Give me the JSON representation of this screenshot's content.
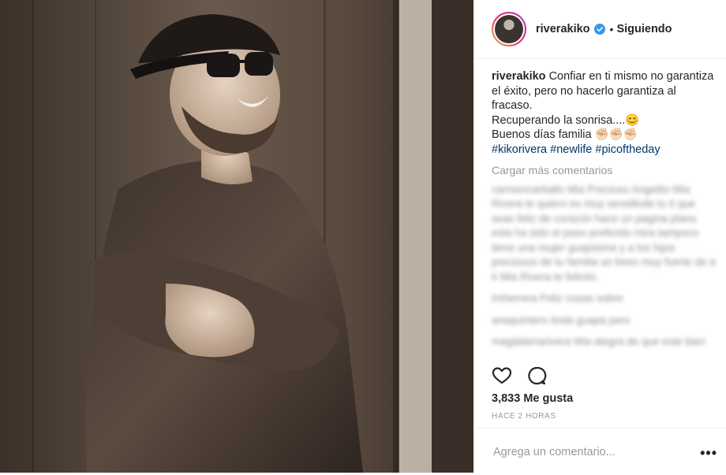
{
  "post": {
    "username": "riverakiko",
    "following_label": "Siguiendo",
    "separator": "•",
    "caption_user": "riverakiko",
    "caption_lines": [
      "Confiar en ti mismo no garantiza el éxito, pero no hacerlo garantiza al fracaso.",
      "Recuperando la sonrisa....😊",
      "Buenos días familia ✊🏻✊🏻✊🏻"
    ],
    "hashtags": [
      "#kikorivera",
      "#newlife",
      "#picoftheday"
    ],
    "load_more": "Cargar más comentarios",
    "blurred_comments": [
      "carmencarballo Mia Precioso Angelito Mia Rivera te quiero es muy sensillode tu ti que seas feliz de corazón hace un pagina plano esta ha sido el paso preferido mira tampoco tiene una mujer guapisima y a los hijos preciosos de tu familia un beso muy fuerte de a ti Mia Rivera te felicito.",
      "imherrera Feliz cosas sobre",
      "anaquintero linda guapa pero",
      "magdalenarivera Mia alegra de que este bien"
    ],
    "likes": "3,833 Me gusta",
    "time": "HACE 2 HORAS",
    "comment_placeholder": "Agrega un comentario...",
    "more_label": "•••"
  },
  "icons": {
    "verified": "verified-badge-icon",
    "like": "heart-icon",
    "comment": "comment-icon",
    "more": "more-options-icon"
  },
  "colors": {
    "verified_blue": "#3897f0",
    "hashtag": "#003569",
    "muted": "#999999",
    "text": "#262626"
  }
}
